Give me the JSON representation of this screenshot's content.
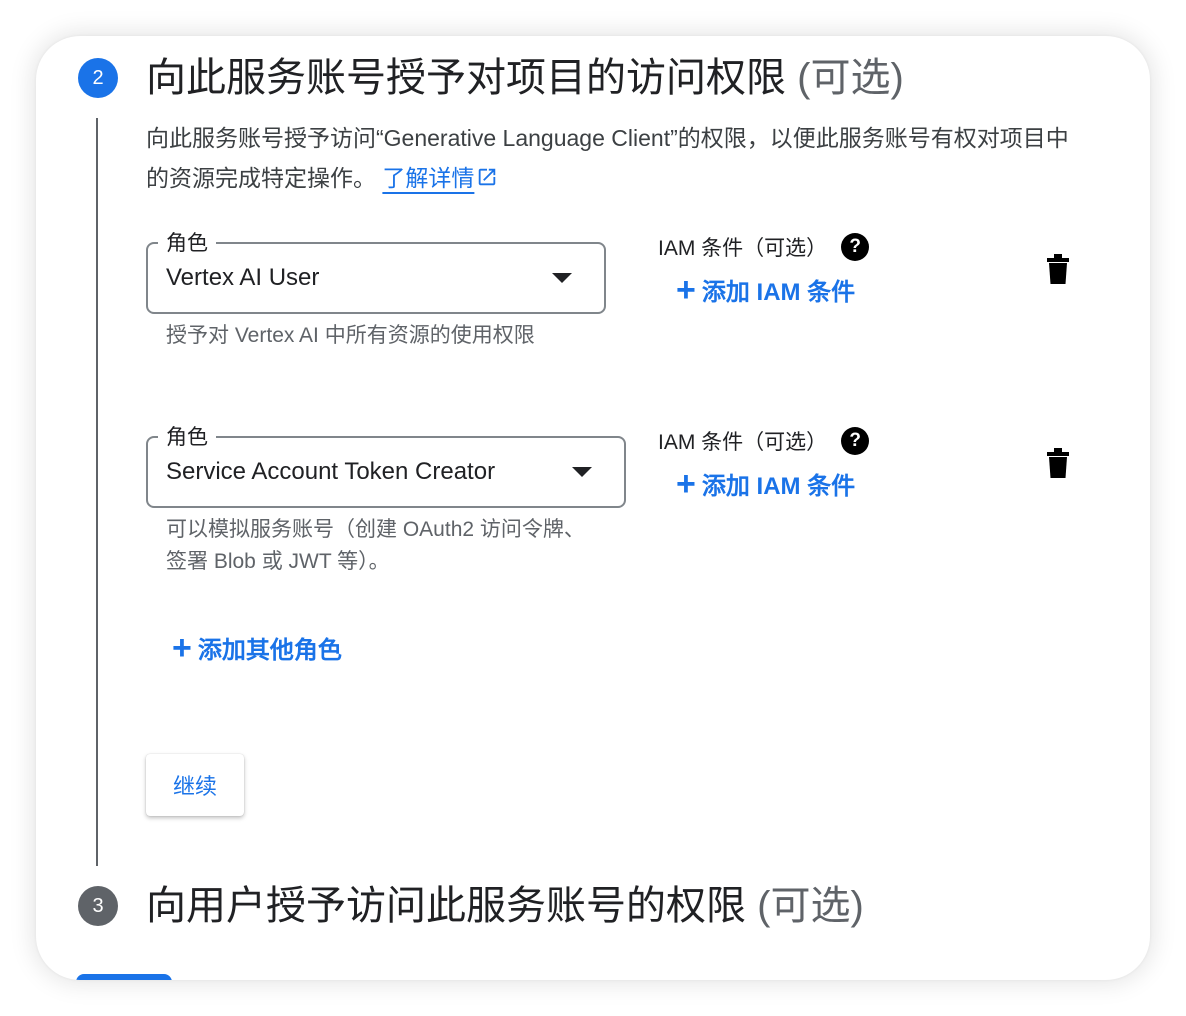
{
  "step2": {
    "number": "2",
    "title": "向此服务账号授予对项目的访问权限",
    "optional": "(可选)",
    "description": "向此服务账号授予访问“Generative Language Client”的权限，以便此服务账号有权对项目中的资源完成特定操作。",
    "learn_more": "了解详情",
    "roles": [
      {
        "label": "角色",
        "value": "Vertex AI User",
        "help": "授予对 Vertex AI 中所有资源的使用权限",
        "iam_label": "IAM 条件（可选）",
        "add_iam": "添加 IAM 条件"
      },
      {
        "label": "角色",
        "value": "Service Account Token Creator",
        "help": "可以模拟服务账号（创建 OAuth2 访问令牌、签署 Blob 或 JWT 等）。",
        "iam_label": "IAM 条件（可选）",
        "add_iam": "添加 IAM 条件"
      }
    ],
    "add_role": "添加其他角色",
    "continue": "继续"
  },
  "step3": {
    "number": "3",
    "title": "向用户授予访问此服务账号的权限",
    "optional": "(可选)"
  },
  "colors": {
    "accent": "#1a73e8",
    "active_step": "#1a73e8",
    "inactive_step": "#5f6368"
  },
  "icons": {
    "help": "help-circle-icon",
    "delete": "trash-icon",
    "external": "external-link-icon",
    "add": "plus-icon",
    "dropdown": "dropdown-arrow-icon"
  }
}
